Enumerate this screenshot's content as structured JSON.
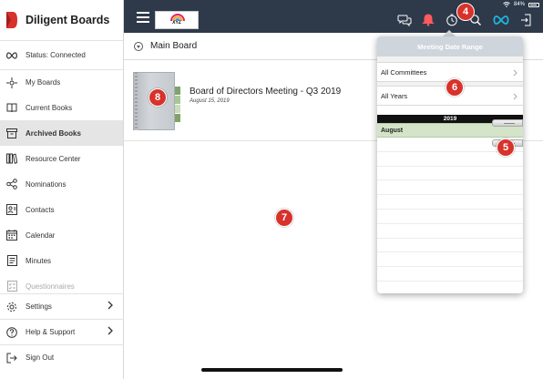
{
  "app": {
    "name": "Diligent Boards"
  },
  "sidebar": {
    "status": {
      "label": "Status: Connected",
      "icon": "infinity-icon"
    },
    "items": [
      {
        "label": "My Boards",
        "icon": "boards-icon"
      },
      {
        "label": "Current Books",
        "icon": "book-icon"
      },
      {
        "label": "Archived Books",
        "icon": "archive-icon",
        "active": true
      },
      {
        "label": "Resource Center",
        "icon": "library-icon"
      },
      {
        "label": "Nominations",
        "icon": "share-icon"
      },
      {
        "label": "Contacts",
        "icon": "contacts-icon"
      },
      {
        "label": "Calendar",
        "icon": "calendar-icon"
      },
      {
        "label": "Minutes",
        "icon": "document-icon"
      },
      {
        "label": "Questionnaires",
        "icon": "checklist-icon",
        "disabled": true
      }
    ],
    "bottom": [
      {
        "label": "Settings",
        "icon": "gear-icon"
      },
      {
        "label": "Help & Support",
        "icon": "help-icon"
      },
      {
        "label": "Sign Out",
        "icon": "sign-out-icon"
      }
    ]
  },
  "topbar": {
    "org_logo_text": "XYZ",
    "battery": "84%",
    "icons": [
      "chat-icon",
      "bell-icon",
      "timer-icon",
      "search-icon",
      "sync-icon",
      "exit-icon"
    ]
  },
  "main": {
    "header_title": "Main Board",
    "books": [
      {
        "title": "Board of Directors Meeting - Q3 2019",
        "date": "August 15, 2019"
      }
    ]
  },
  "popover": {
    "title": "Meeting Date Range",
    "committee_filter": "All Committees",
    "year_filter": "All Years",
    "year": "2019",
    "month": "August"
  },
  "callouts": {
    "c4": "4",
    "c5": "5",
    "c6": "6",
    "c7": "7",
    "c8": "8"
  },
  "colors": {
    "topbar": "#2e3a4a",
    "brand_red": "#d7322b",
    "accent_cyan": "#1fb6e0",
    "month_highlight": "#d4e4c8"
  }
}
